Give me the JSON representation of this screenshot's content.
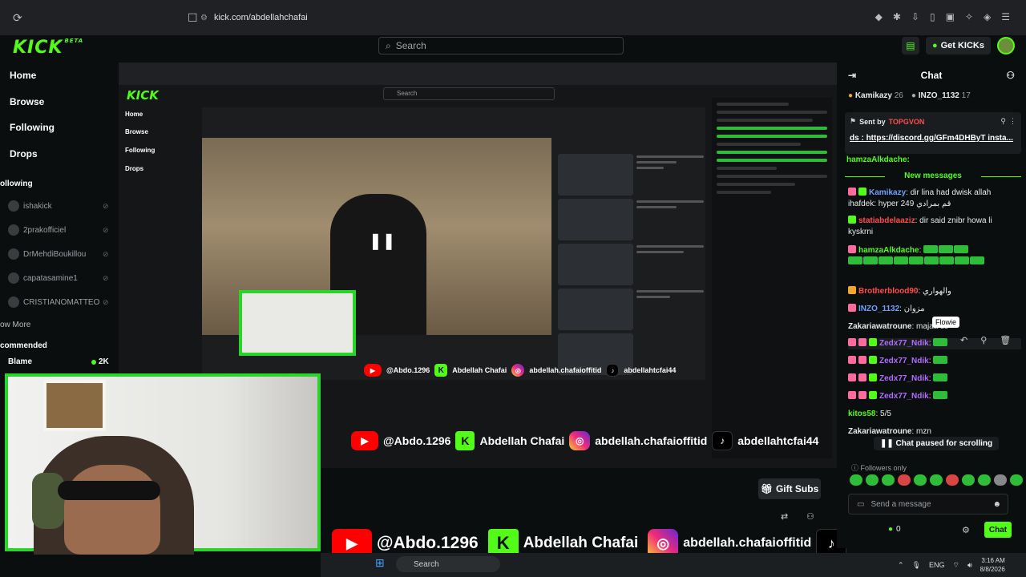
{
  "browser": {
    "url": "kick.com/abdellahchafai"
  },
  "header": {
    "logo": "KICK",
    "logo_badge": "BETA",
    "search_placeholder": "Search",
    "get_kicks": "Get KICKs"
  },
  "sidebar": {
    "nav": [
      {
        "label": "Home"
      },
      {
        "label": "Browse"
      },
      {
        "label": "Following"
      },
      {
        "label": "Drops"
      }
    ],
    "following_title": "ollowing",
    "following": [
      "ishakick",
      "2prakofficiel",
      "DrMehdiBoukillou",
      "capatasamine1",
      "CRISTIANOMATTEO"
    ],
    "show_more": "ow More",
    "recommended_title": "commended",
    "recommended": [
      {
        "name": "Blame",
        "viewers": "2K"
      }
    ]
  },
  "overlay": {
    "youtube": "@Abdo.1296",
    "kick": "Abdellah Chafai",
    "instagram": "abdellah.chafaioffitid",
    "tiktok": "abdellahtcfai44"
  },
  "stream_actions": {
    "gift_subs": "Gift Subs"
  },
  "chat": {
    "title": "Chat",
    "gifters": [
      {
        "name": "Kamikazy",
        "count": "26"
      },
      {
        "name": "INZO_1132",
        "count": "17"
      }
    ],
    "pinned": {
      "sent_by_label": "Sent by",
      "sent_by": "TOPGVON",
      "user": "ds",
      "link": "https://discord.gg/GFm4DHByT insta..."
    },
    "prev_user": "hamzaAlkdache:",
    "new_messages": "New messages",
    "messages": [
      {
        "user": "Kamikazy",
        "text": "dir lina had dwisk allah ihafdek: hyper 249 قم بمرادي"
      },
      {
        "user": "statiabdelaaziz",
        "text": "dir said znibr howa li kyskrni"
      },
      {
        "user": "hamzaAlkdache",
        "text": ""
      },
      {
        "user": "Brotherblood90",
        "text": "والهواري"
      },
      {
        "user": "INZO_1132",
        "text": "مزوان"
      },
      {
        "user": "Zakariawatroune",
        "text": "majaa ss"
      },
      {
        "user": "Zedx77_Ndik",
        "text": ""
      },
      {
        "user": "Zedx77_Ndik",
        "text": ""
      },
      {
        "user": "Zedx77_Ndik",
        "text": ""
      },
      {
        "user": "Zedx77_Ndik",
        "text": ""
      },
      {
        "user": "kitos58",
        "text": "5/5"
      },
      {
        "user": "Zakariawatroune",
        "text": "mzn"
      }
    ],
    "tooltip": "Flowie",
    "paused": "Chat paused for scrolling",
    "followers_only": "Followers only",
    "send_placeholder": "Send a message",
    "send_button": "Chat",
    "kicks_count": "0"
  },
  "taskbar": {
    "search": "Search",
    "lang": "ENG",
    "time": "3:16 AM",
    "date": "8/8/2026"
  }
}
